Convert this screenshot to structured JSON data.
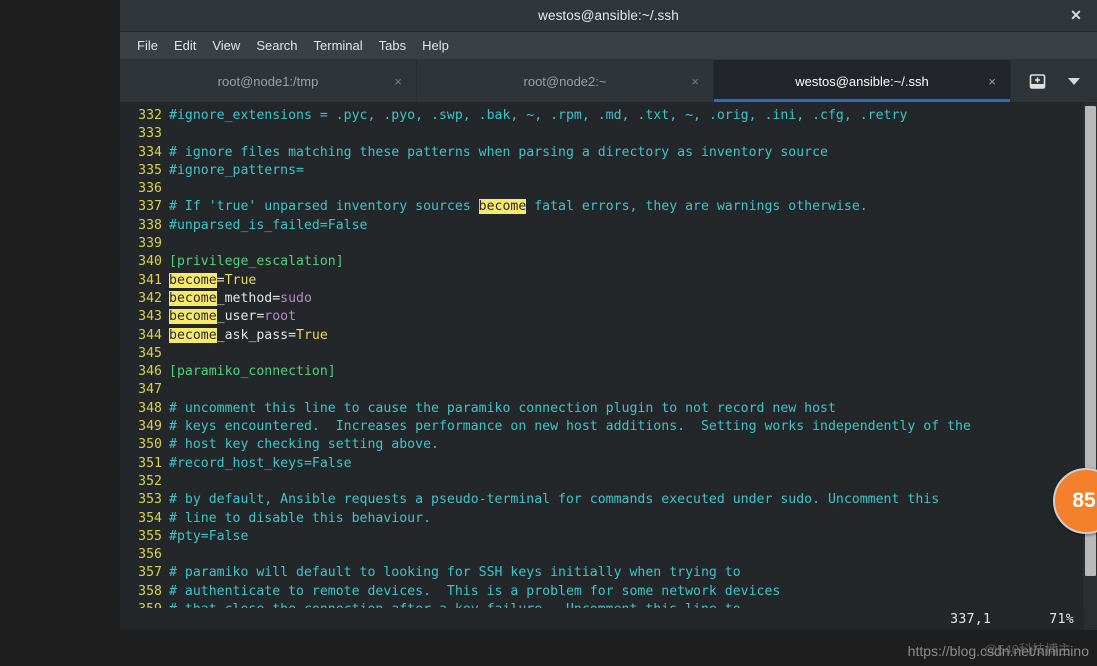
{
  "window": {
    "title": "westos@ansible:~/.ssh",
    "close_label": "✕"
  },
  "menubar": {
    "items": [
      {
        "label": "File"
      },
      {
        "label": "Edit"
      },
      {
        "label": "View"
      },
      {
        "label": "Search"
      },
      {
        "label": "Terminal"
      },
      {
        "label": "Tabs"
      },
      {
        "label": "Help"
      }
    ]
  },
  "tabbar": {
    "tabs": [
      {
        "label": "root@node1:/tmp",
        "close": "×",
        "active": false
      },
      {
        "label": "root@node2:~",
        "close": "×",
        "active": false
      },
      {
        "label": "westos@ansible:~/.ssh",
        "close": "×",
        "active": true
      }
    ],
    "new_tab_icon": "new-tab-icon",
    "dropdown_icon": "chevron-down-icon"
  },
  "terminal": {
    "lines": [
      {
        "num": "332",
        "segments": [
          {
            "t": "#ignore_extensions = .pyc, .pyo, .swp, .bak, ~, .rpm, .md, .txt, ~, .orig, .ini, .cfg, .retry",
            "c": "cmt"
          }
        ]
      },
      {
        "num": "333",
        "segments": []
      },
      {
        "num": "334",
        "segments": [
          {
            "t": "# ignore files matching these patterns when parsing a directory as inventory source",
            "c": "cmt"
          }
        ]
      },
      {
        "num": "335",
        "segments": [
          {
            "t": "#ignore_patterns=",
            "c": "cmt"
          }
        ]
      },
      {
        "num": "336",
        "segments": []
      },
      {
        "num": "337",
        "segments": [
          {
            "t": "# If 'true' unparsed inventory sources ",
            "c": "cmt"
          },
          {
            "t": "become",
            "c": "hl"
          },
          {
            "t": " fatal errors, they are warnings otherwise.",
            "c": "cmt"
          }
        ]
      },
      {
        "num": "338",
        "segments": [
          {
            "t": "#unparsed_is_failed=False",
            "c": "cmt"
          }
        ]
      },
      {
        "num": "339",
        "segments": []
      },
      {
        "num": "340",
        "segments": [
          {
            "t": "[privilege_escalation]",
            "c": "sect"
          }
        ]
      },
      {
        "num": "341",
        "segments": [
          {
            "t": "become",
            "c": "hl"
          },
          {
            "t": "=",
            "c": "key"
          },
          {
            "t": "True",
            "c": "val-y"
          }
        ]
      },
      {
        "num": "342",
        "segments": [
          {
            "t": "become",
            "c": "hl"
          },
          {
            "t": "_method=",
            "c": "key"
          },
          {
            "t": "sudo",
            "c": "val-p"
          }
        ]
      },
      {
        "num": "343",
        "segments": [
          {
            "t": "become",
            "c": "hl"
          },
          {
            "t": "_user=",
            "c": "key"
          },
          {
            "t": "root",
            "c": "val-p"
          }
        ]
      },
      {
        "num": "344",
        "segments": [
          {
            "t": "become",
            "c": "hl"
          },
          {
            "t": "_ask_pass=",
            "c": "key"
          },
          {
            "t": "True",
            "c": "val-y"
          }
        ]
      },
      {
        "num": "345",
        "segments": []
      },
      {
        "num": "346",
        "segments": [
          {
            "t": "[paramiko_connection]",
            "c": "sect"
          }
        ]
      },
      {
        "num": "347",
        "segments": []
      },
      {
        "num": "348",
        "segments": [
          {
            "t": "# uncomment this line to cause the paramiko connection plugin to not record new host",
            "c": "cmt"
          }
        ]
      },
      {
        "num": "349",
        "segments": [
          {
            "t": "# keys encountered.  Increases performance on new host additions.  Setting works independently of the",
            "c": "cmt"
          }
        ]
      },
      {
        "num": "350",
        "segments": [
          {
            "t": "# host key checking setting above.",
            "c": "cmt"
          }
        ]
      },
      {
        "num": "351",
        "segments": [
          {
            "t": "#record_host_keys=False",
            "c": "cmt"
          }
        ]
      },
      {
        "num": "352",
        "segments": []
      },
      {
        "num": "353",
        "segments": [
          {
            "t": "# by default, Ansible requests a pseudo-terminal for commands executed under sudo. Uncomment this",
            "c": "cmt"
          }
        ]
      },
      {
        "num": "354",
        "segments": [
          {
            "t": "# line to disable this behaviour.",
            "c": "cmt"
          }
        ]
      },
      {
        "num": "355",
        "segments": [
          {
            "t": "#pty=False",
            "c": "cmt"
          }
        ]
      },
      {
        "num": "356",
        "segments": []
      },
      {
        "num": "357",
        "segments": [
          {
            "t": "# paramiko will default to looking for SSH keys initially when trying to",
            "c": "cmt"
          }
        ]
      },
      {
        "num": "358",
        "segments": [
          {
            "t": "# authenticate to remote devices.  This is a problem for some network devices",
            "c": "cmt"
          }
        ]
      },
      {
        "num": "359",
        "segments": [
          {
            "t": "# that close the connection after a key failure.  Uncomment this line to",
            "c": "cmt"
          }
        ]
      }
    ],
    "status": {
      "position": "337,1",
      "percent": "71%"
    }
  },
  "badge": {
    "value": "85"
  },
  "watermark": {
    "url": "https://blog.csdn.net/ninimino",
    "overlay": "@540科技博主"
  },
  "colors": {
    "titlebar_bg": "#31363b",
    "menubar_bg": "#3b4045",
    "tabbar_bg": "#2f3438",
    "active_tab_bg": "#22262a",
    "tab_underline": "#2a6ec4",
    "terminal_bg": "#232729",
    "comment": "#3ec4c9",
    "section": "#4fd07a",
    "linenum": "#d7d34b",
    "highlight": "#f7e96a",
    "value_purple": "#b98bc9",
    "value_yellow": "#e6d95e",
    "badge": "#f3802a"
  }
}
